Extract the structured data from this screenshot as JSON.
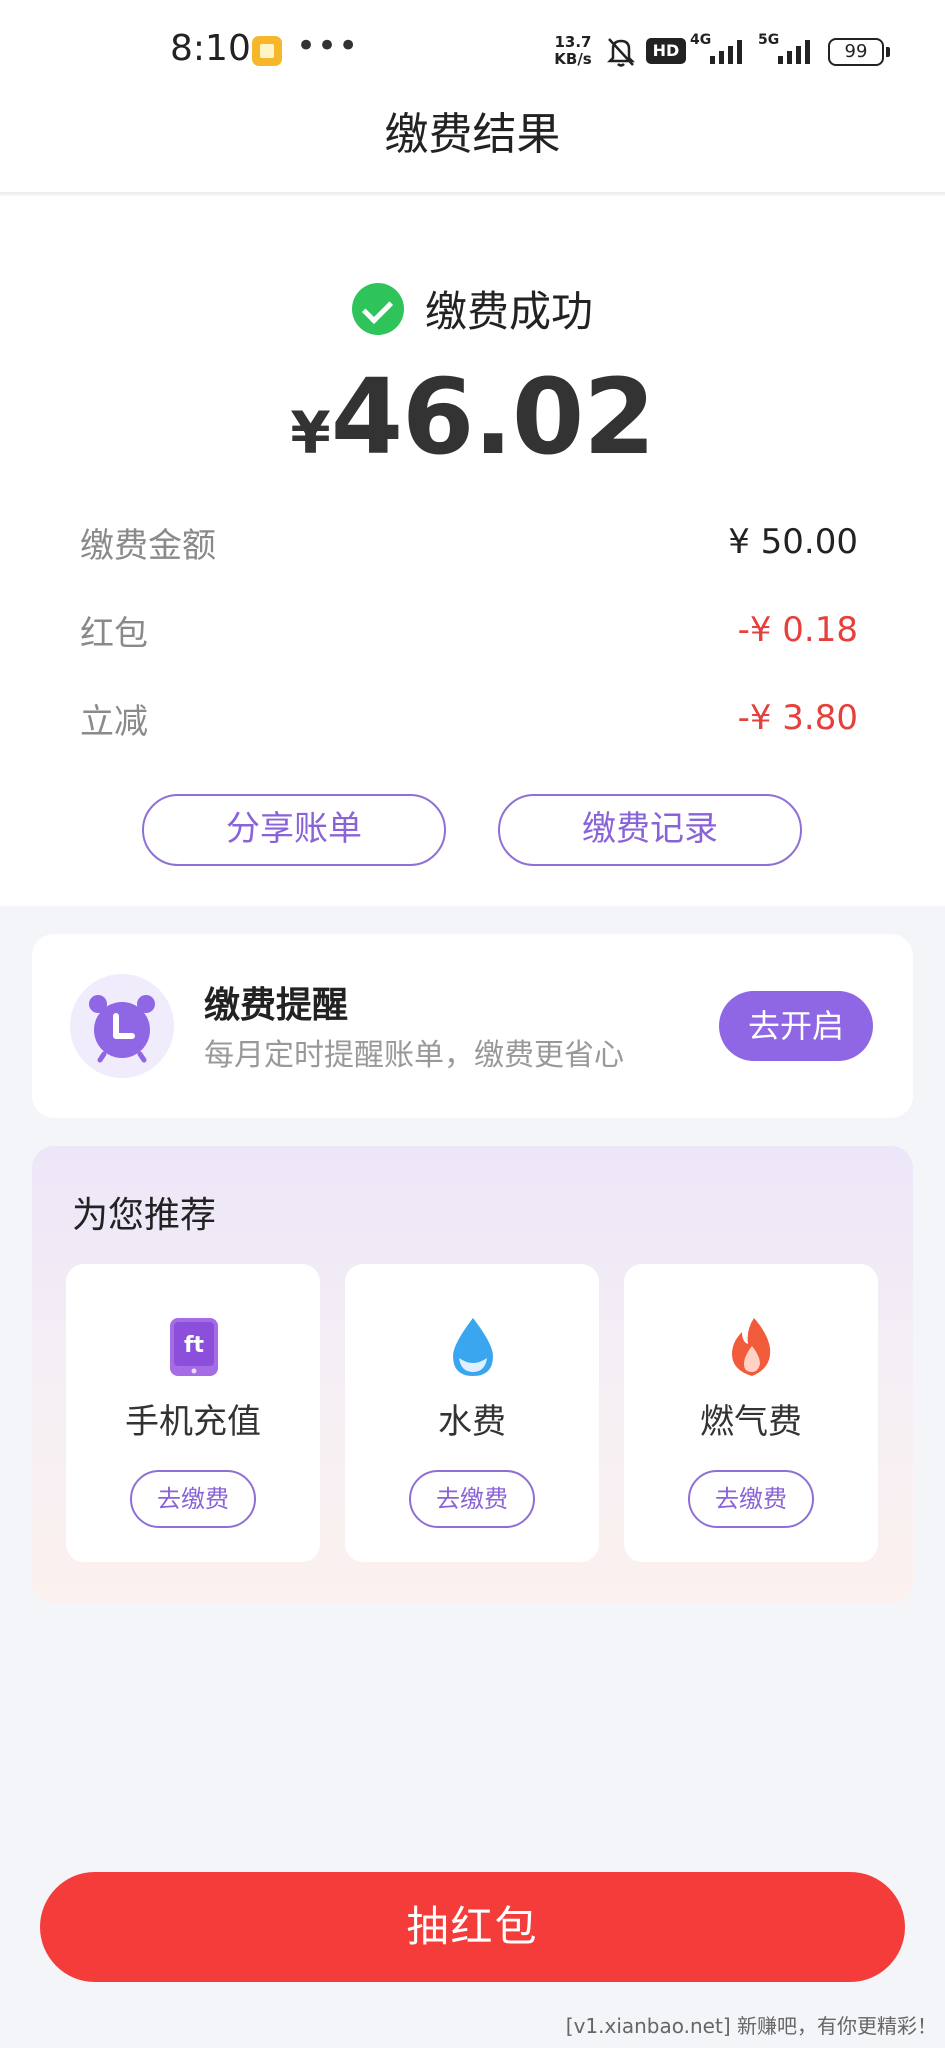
{
  "status_bar": {
    "time": "8:10",
    "speed_value": "13.7",
    "speed_unit": "KB/s",
    "hd_label": "HD",
    "net1": "4G",
    "net2": "5G",
    "battery": "99"
  },
  "header": {
    "title": "缴费结果"
  },
  "result": {
    "status": "缴费成功",
    "currency": "¥",
    "amount": "46.02",
    "details": [
      {
        "label": "缴费金额",
        "value": "¥ 50.00"
      },
      {
        "label": "红包",
        "value": "-¥ 0.18"
      },
      {
        "label": "立减",
        "value": "-¥ 3.80"
      }
    ],
    "share_label": "分享账单",
    "records_label": "缴费记录"
  },
  "reminder": {
    "title": "缴费提醒",
    "subtitle": "每月定时提醒账单，缴费更省心",
    "button": "去开启"
  },
  "recommend": {
    "title": "为您推荐",
    "items": [
      {
        "label": "手机充值",
        "button": "去缴费",
        "icon": "phone-recharge-icon"
      },
      {
        "label": "水费",
        "button": "去缴费",
        "icon": "water-drop-icon"
      },
      {
        "label": "燃气费",
        "button": "去缴费",
        "icon": "flame-icon"
      }
    ]
  },
  "bottom": {
    "button": "抽红包",
    "watermark": "[v1.xianbao.net] 新赚吧，有你更精彩！"
  },
  "colors": {
    "accent_purple": "#8f66e4",
    "success_green": "#2fc45a",
    "discount_red": "#e5403c",
    "cta_red": "#f43d3a"
  }
}
